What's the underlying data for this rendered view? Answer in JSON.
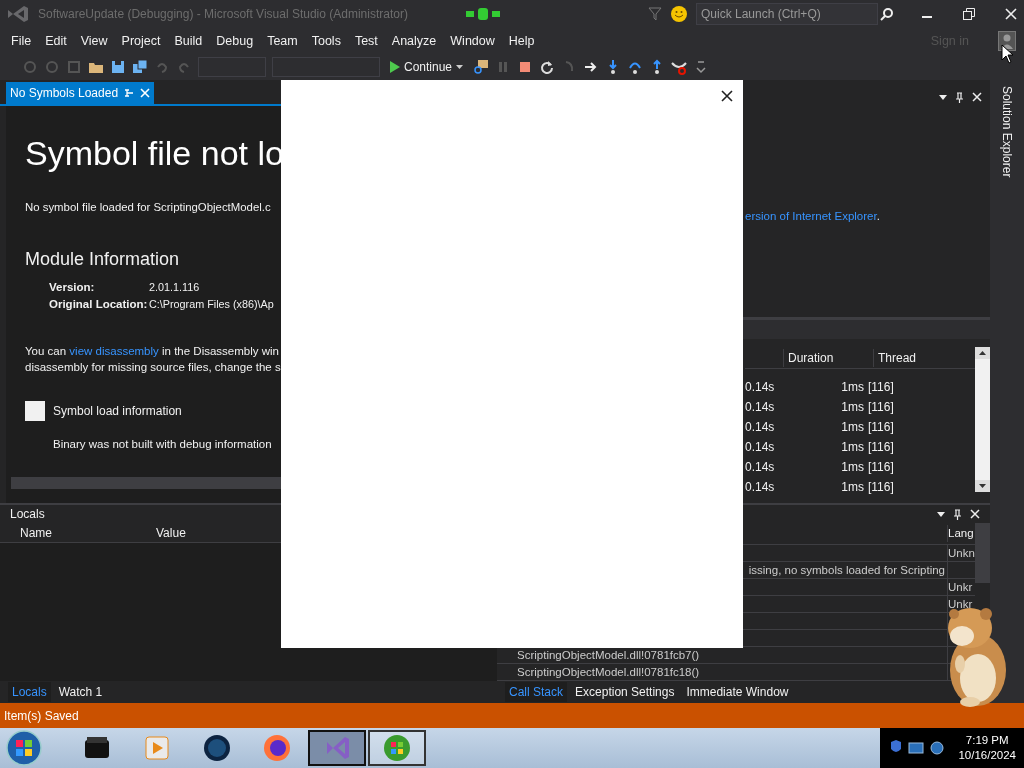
{
  "window": {
    "title": "SoftwareUpdate (Debugging) - Microsoft Visual Studio (Administrator)"
  },
  "quick_launch": {
    "placeholder": "Quick Launch (Ctrl+Q)"
  },
  "menu": [
    "File",
    "Edit",
    "View",
    "Project",
    "Build",
    "Debug",
    "Team",
    "Tools",
    "Test",
    "Analyze",
    "Window",
    "Help"
  ],
  "sign_in": "Sign in",
  "toolbar": {
    "continue": "Continue"
  },
  "document": {
    "tab": {
      "label": "No Symbols Loaded",
      "selected": true
    },
    "heading": "Symbol file not lo",
    "message": "No symbol file loaded for ScriptingObjectModel.c",
    "module_heading": "Module Information",
    "fields": [
      {
        "label": "Version:",
        "value": "2.01.1.116"
      },
      {
        "label": "Original Location:",
        "value": "C:\\Program Files (x86)\\Ap"
      }
    ],
    "disassembly": {
      "before": "You can",
      "link": "view disassembly",
      "after": "in the Disassembly win",
      "line2": "disassembly for missing source files, change the s"
    },
    "symbol_load": {
      "label": "Symbol load information",
      "detail": "Binary was not built with debug information"
    }
  },
  "diagnostics": {
    "link": "ersion of Internet Explorer",
    "after": ".",
    "columns": [
      "Duration",
      "Thread"
    ],
    "rows": [
      {
        "column_1": "0.14s",
        "duration": "1ms",
        "thread": "[116]"
      },
      {
        "column_1": "0.14s",
        "duration": "1ms",
        "thread": "[116]"
      },
      {
        "column_1": "0.14s",
        "duration": "1ms",
        "thread": "[116]"
      },
      {
        "column_1": "0.14s",
        "duration": "1ms",
        "thread": "[116]"
      },
      {
        "column_1": "0.14s",
        "duration": "1ms",
        "thread": "[116]"
      },
      {
        "column_1": "0.14s",
        "duration": "1ms",
        "thread": "[116]"
      }
    ]
  },
  "solution_explorer": "Solution Explorer",
  "locals": {
    "title": "Locals",
    "columns": [
      "Name",
      "Value"
    ],
    "tabs": [
      {
        "label": "Locals",
        "selected": true
      },
      {
        "label": "Watch 1",
        "selected": false
      }
    ]
  },
  "call_stack": {
    "columns": [
      "Lang"
    ],
    "rows": [
      {
        "lang": "Unkn"
      },
      {
        "message": "issing, no symbols loaded for Scripting"
      },
      {
        "lang": "Unkr"
      },
      {
        "lang": "Unkr"
      },
      {
        "name": "ScriptingObjectModel.dll!0781fcb7()"
      },
      {
        "name": "ScriptingObjectModel.dll!0781fc18()"
      }
    ],
    "tabs": [
      {
        "label": "Call Stack",
        "selected": true
      },
      {
        "label": "Exception Settings",
        "selected": false
      },
      {
        "label": "Immediate Window",
        "selected": false
      }
    ]
  },
  "status_bar": "Item(s) Saved",
  "taskbar": {
    "apps": [
      {
        "kind": "box",
        "selected": false,
        "open": false
      },
      {
        "kind": "media",
        "selected": false,
        "open": false
      },
      {
        "kind": "globe",
        "selected": false,
        "open": false
      },
      {
        "kind": "firefox",
        "selected": false,
        "open": false
      },
      {
        "kind": "vs",
        "selected": true,
        "open": true
      },
      {
        "kind": "windows",
        "selected": false,
        "open": true
      }
    ],
    "time": "7:19 PM",
    "date": "10/16/2024"
  },
  "dialog": {
    "kind": "blank"
  }
}
